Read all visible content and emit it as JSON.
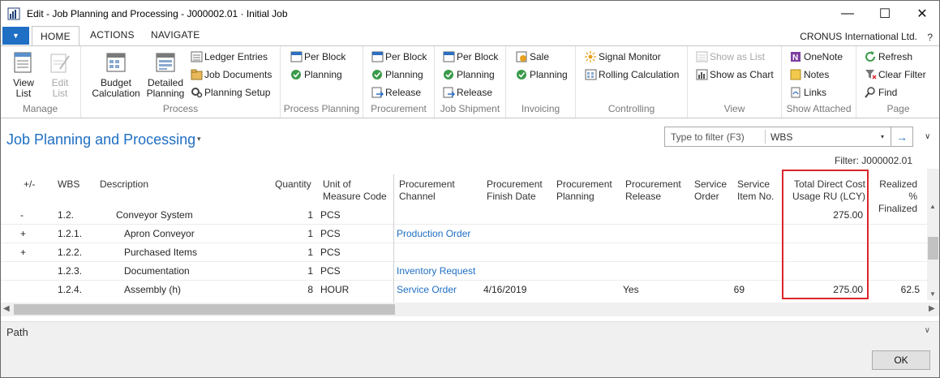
{
  "window": {
    "title": "Edit - Job Planning and Processing - J000002.01 · Initial Job",
    "minimize": "—",
    "maximize": "☐",
    "close": "✕"
  },
  "ribbon_tabs": {
    "app_menu": "▼",
    "home": "HOME",
    "actions": "ACTIONS",
    "navigate": "NAVIGATE",
    "company": "CRONUS International Ltd.",
    "help": "?"
  },
  "ribbon": {
    "manage": {
      "label": "Manage",
      "view_list": "View List",
      "edit_list": "Edit List"
    },
    "process": {
      "label": "Process",
      "budget_calculation": "Budget Calculation",
      "detailed_planning": "Detailed Planning",
      "ledger_entries": "Ledger Entries",
      "job_documents": "Job Documents",
      "planning_setup": "Planning Setup"
    },
    "process_planning": {
      "label": "Process Planning",
      "per_block": "Per Block",
      "planning": "Planning"
    },
    "procurement": {
      "label": "Procurement",
      "per_block": "Per Block",
      "planning": "Planning",
      "release": "Release"
    },
    "job_shipment": {
      "label": "Job Shipment",
      "per_block": "Per Block",
      "planning": "Planning",
      "release": "Release"
    },
    "invoicing": {
      "label": "Invoicing",
      "sale": "Sale",
      "planning": "Planning"
    },
    "controlling": {
      "label": "Controlling",
      "signal_monitor": "Signal Monitor",
      "rolling_calculation": "Rolling Calculation"
    },
    "view": {
      "label": "View",
      "show_as_list": "Show as List",
      "show_as_chart": "Show as Chart"
    },
    "show_attached": {
      "label": "Show Attached",
      "onenote": "OneNote",
      "notes": "Notes",
      "links": "Links"
    },
    "page": {
      "label": "Page",
      "refresh": "Refresh",
      "clear_filter": "Clear Filter",
      "find": "Find"
    }
  },
  "page": {
    "title": "Job Planning and Processing",
    "title_caret": "▾",
    "filter_placeholder": "Type to filter (F3)",
    "filter_field": "WBS",
    "filter_dropdown": "▾",
    "go": "→",
    "collapse": "∨",
    "filter_label": "Filter: J000002.01"
  },
  "grid": {
    "headers": {
      "plusminus": "+/-",
      "wbs": "WBS",
      "description": "Description",
      "quantity": "Quantity",
      "uom_1": "Unit of",
      "uom_2": "Measure Code",
      "proc_channel_1": "Procurement",
      "proc_channel_2": "Channel",
      "proc_finish_1": "Procurement",
      "proc_finish_2": "Finish Date",
      "proc_planning_1": "Procurement",
      "proc_planning_2": "Planning",
      "proc_release_1": "Procurement",
      "proc_release_2": "Release",
      "service_order_1": "Service",
      "service_order_2": "Order",
      "service_item_1": "Service",
      "service_item_2": "Item No.",
      "total_direct_1": "Total Direct Cost",
      "total_direct_2": "Usage RU (LCY)",
      "realized_1": "Realized %",
      "realized_2": "Finalized"
    },
    "rows": [
      {
        "pm": "-",
        "wbs": "1.2.",
        "desc": "Conveyor System",
        "qty": "1",
        "uom": "PCS",
        "channel": "",
        "finish": "",
        "planning": "",
        "release": "",
        "svc_order": "",
        "svc_item": "",
        "total": "275.00",
        "realized": ""
      },
      {
        "pm": "+",
        "wbs": "1.2.1.",
        "desc": "Apron Conveyor",
        "qty": "1",
        "uom": "PCS",
        "channel": "Production Order",
        "finish": "",
        "planning": "",
        "release": "",
        "svc_order": "",
        "svc_item": "",
        "total": "",
        "realized": ""
      },
      {
        "pm": "+",
        "wbs": "1.2.2.",
        "desc": "Purchased Items",
        "qty": "1",
        "uom": "PCS",
        "channel": "",
        "finish": "",
        "planning": "",
        "release": "",
        "svc_order": "",
        "svc_item": "",
        "total": "",
        "realized": ""
      },
      {
        "pm": "",
        "wbs": "1.2.3.",
        "desc": "Documentation",
        "qty": "1",
        "uom": "PCS",
        "channel": "Inventory Request",
        "finish": "",
        "planning": "",
        "release": "",
        "svc_order": "",
        "svc_item": "",
        "total": "",
        "realized": ""
      },
      {
        "pm": "",
        "wbs": "1.2.4.",
        "desc": "Assembly (h)",
        "qty": "8",
        "uom": "HOUR",
        "channel": "Service Order",
        "finish": "4/16/2019",
        "planning": "",
        "release": "Yes",
        "svc_order": "",
        "svc_item": "69",
        "total": "275.00",
        "realized": "62.5"
      }
    ]
  },
  "scroll": {
    "up": "▲",
    "down": "▼",
    "left": "◀",
    "right": "▶"
  },
  "factbox": {
    "path": "Path",
    "expand": "∨"
  },
  "footer": {
    "ok": "OK"
  }
}
